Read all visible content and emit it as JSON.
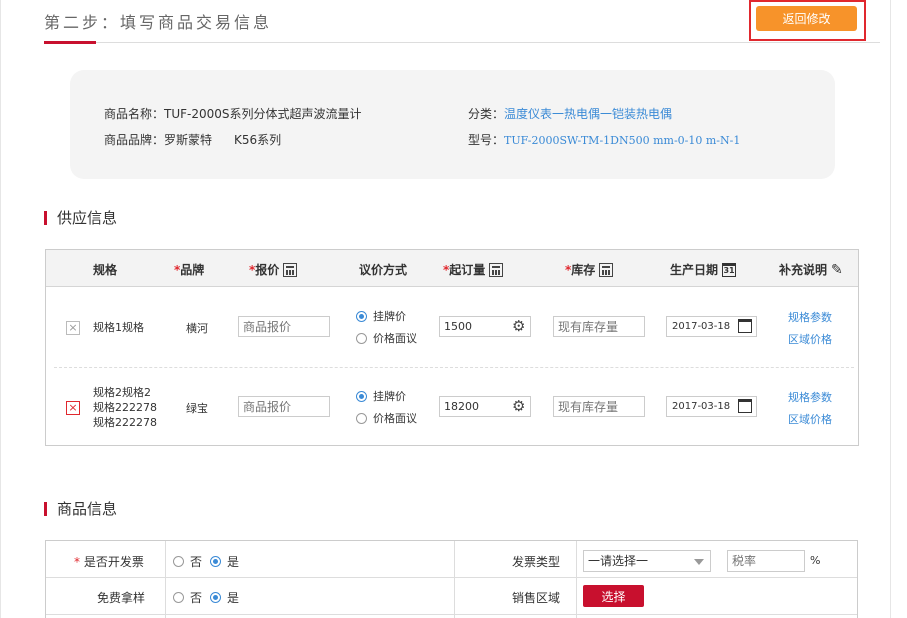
{
  "header": {
    "step_title": "第二步：填写商品交易信息",
    "back_button": "返回修改"
  },
  "summary": {
    "name_label": "商品名称：",
    "name_value": "TUF-2000S系列分体式超声波流量计",
    "brand_label": "商品品牌：",
    "brand_value": "罗斯蒙特",
    "series_value": "K56系列",
    "category_label": "分类：",
    "category_value": "温度仪表一热电偶一铠装热电偶",
    "model_label": "型号：",
    "model_value": "TUF-2000SW-TM-1DN500 mm-0-10 m-N-1"
  },
  "supply": {
    "section_title": "供应信息",
    "columns": {
      "spec": "规格",
      "brand": "品牌",
      "price": "报价",
      "negotiation": "议价方式",
      "moq": "起订量",
      "stock": "库存",
      "production_date": "生产日期",
      "remarks": "补充说明"
    },
    "required_mark": "*",
    "date_icon_text": "31",
    "rows": [
      {
        "spec_lines": [
          "规格1规格"
        ],
        "brand": "横河",
        "price_placeholder": "商品报价",
        "radio_listed": "挂牌价",
        "radio_negotiable": "价格面议",
        "moq_value": "1500",
        "stock_placeholder": "现有库存量",
        "date": "2017-03-18",
        "link_params": "规格参数",
        "link_region_price": "区域价格",
        "delete_icon": "×"
      },
      {
        "spec_lines": [
          "规格2规格2",
          "规格222278",
          "规格222278"
        ],
        "brand": "绿宝",
        "price_placeholder": "商品报价",
        "radio_listed": "挂牌价",
        "radio_negotiable": "价格面议",
        "moq_value": "18200",
        "stock_placeholder": "现有库存量",
        "date": "2017-03-18",
        "link_params": "规格参数",
        "link_region_price": "区域价格",
        "delete_icon": "×"
      }
    ]
  },
  "product": {
    "section_title": "商品信息",
    "invoice_label": "是否开发票",
    "invoice_required": "*",
    "no_label": "否",
    "yes_label": "是",
    "free_sample_label": "免费拿样",
    "invoice_type_label": "发票类型",
    "invoice_type_selected": "一请选择一",
    "tax_placeholder": "税率",
    "percent": "%",
    "sales_region_label": "销售区域",
    "choose_button": "选择"
  },
  "colors": {
    "accent_red": "#c8102e",
    "orange": "#f7932a",
    "link_blue": "#3a8ad6"
  }
}
